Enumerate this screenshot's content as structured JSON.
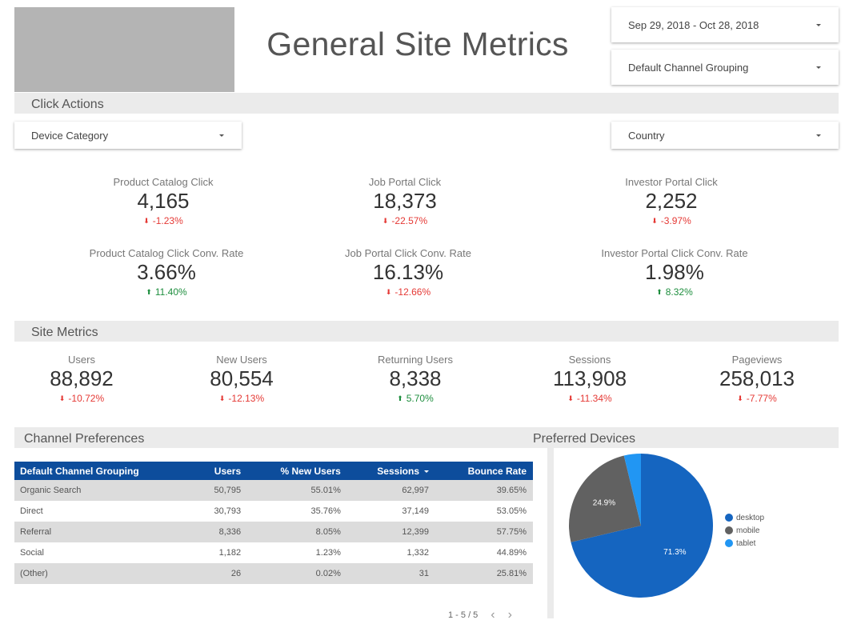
{
  "header": {
    "title": "General Site Metrics",
    "date_range": "Sep 29, 2018 - Oct 28, 2018",
    "channel_filter": "Default Channel Grouping"
  },
  "click_actions": {
    "title": "Click Actions",
    "device_filter": "Device Category",
    "country_filter": "Country",
    "cards": [
      {
        "label": "Product Catalog Click",
        "value": "4,165",
        "delta": "-1.23%",
        "direction": "down"
      },
      {
        "label": "Job Portal Click",
        "value": "18,373",
        "delta": "-22.57%",
        "direction": "down"
      },
      {
        "label": "Investor Portal Click",
        "value": "2,252",
        "delta": "-3.97%",
        "direction": "down"
      },
      {
        "label": "Product Catalog Click Conv. Rate",
        "value": "3.66%",
        "delta": "11.40%",
        "direction": "up"
      },
      {
        "label": "Job Portal Click Conv. Rate",
        "value": "16.13%",
        "delta": "-12.66%",
        "direction": "down"
      },
      {
        "label": "Investor Portal Click Conv. Rate",
        "value": "1.98%",
        "delta": "8.32%",
        "direction": "up"
      }
    ]
  },
  "site_metrics": {
    "title": "Site Metrics",
    "cards": [
      {
        "label": "Users",
        "value": "88,892",
        "delta": "-10.72%",
        "direction": "down"
      },
      {
        "label": "New Users",
        "value": "80,554",
        "delta": "-12.13%",
        "direction": "down"
      },
      {
        "label": "Returning Users",
        "value": "8,338",
        "delta": "5.70%",
        "direction": "up"
      },
      {
        "label": "Sessions",
        "value": "113,908",
        "delta": "-11.34%",
        "direction": "down"
      },
      {
        "label": "Pageviews",
        "value": "258,013",
        "delta": "-7.77%",
        "direction": "down"
      }
    ]
  },
  "channel_preferences": {
    "title": "Channel Preferences",
    "columns": [
      "Default Channel Grouping",
      "Users",
      "% New Users",
      "Sessions",
      "Bounce Rate"
    ],
    "sorted_column": "Sessions",
    "rows": [
      [
        "Organic Search",
        "50,795",
        "55.01%",
        "62,997",
        "39.65%"
      ],
      [
        "Direct",
        "30,793",
        "35.76%",
        "37,149",
        "53.05%"
      ],
      [
        "Referral",
        "8,336",
        "8.05%",
        "12,399",
        "57.75%"
      ],
      [
        "Social",
        "1,182",
        "1.23%",
        "1,332",
        "44.89%"
      ],
      [
        "(Other)",
        "26",
        "0.02%",
        "31",
        "25.81%"
      ]
    ],
    "pagination": "1 - 5 / 5",
    "prev_icon": "‹",
    "next_icon": "›"
  },
  "preferred_devices": {
    "title": "Preferred Devices"
  },
  "chart_data": {
    "type": "pie",
    "title": "Preferred Devices",
    "categories": [
      "desktop",
      "mobile",
      "tablet"
    ],
    "values": [
      71.3,
      24.9,
      3.8
    ],
    "labels": [
      "71.3%",
      "24.9%",
      ""
    ],
    "colors": [
      "#1565c0",
      "#616161",
      "#2196f3"
    ],
    "legend": "right"
  },
  "colors": {
    "header_blue": "#0d4d9c",
    "positive": "#1e8e3e",
    "negative": "#e53935",
    "section_bg": "#ebebeb"
  },
  "icons": {
    "down_arrow": "⬇",
    "up_arrow": "⬆"
  }
}
